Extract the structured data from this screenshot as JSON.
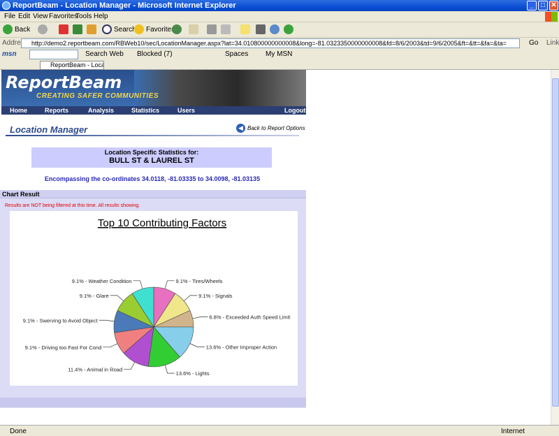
{
  "window": {
    "title": "ReportBeam - Location Manager - Microsoft Internet Explorer",
    "minimize": "_",
    "maximize": "□",
    "close": "✕"
  },
  "menu": [
    "File",
    "Edit",
    "View",
    "Favorites",
    "Tools",
    "Help"
  ],
  "toolbar": {
    "back": "Back",
    "search": "Search",
    "favorites": "Favorites"
  },
  "address": {
    "label": "Address",
    "url": "http://demo2.reportbeam.com/RBWeb10/sec/LocationManager.aspx?lat=34.010800000000008&long=-81.0323350000000008&fd=8/6/2003&td=9/6/2005&ft=&tt=&fa=&ta=",
    "go": "Go",
    "links": "Links"
  },
  "msn": {
    "brand": "msn",
    "search_web": "Search Web",
    "blocked": "Blocked (7)",
    "spaces": "Spaces",
    "mymsn": "My MSN"
  },
  "tab": {
    "label": "ReportBeam - Locatio..."
  },
  "page": {
    "logo": "ReportBeam",
    "tagline": "CREATING SAFER COMMUNITIES",
    "nav": [
      "Home",
      "Reports",
      "Analysis",
      "Statistics",
      "Users",
      "Logout"
    ],
    "title": "Location Manager",
    "back_link": "Back to Report Options",
    "stat_label": "Location Specific Statistics for:",
    "location": "BULL ST & LAUREL ST",
    "coords": "Encompassing the co-ordinates 34.0118, -81.03335 to 34.0098, -81.03135",
    "panel_title": "Chart Result",
    "warning": "Results are NOT being filtered at this time. All results showing."
  },
  "status": {
    "left": "Done",
    "zone": "Internet"
  },
  "chart_data": {
    "type": "pie",
    "title": "Top 10 Contributing Factors",
    "slices": [
      {
        "label": "9.1% - Tires/Wheels",
        "value": 9.1,
        "color": "#e870c0"
      },
      {
        "label": "9.1% - Signals",
        "value": 9.1,
        "color": "#f0e68c"
      },
      {
        "label": "6.8% - Exceeded Auth Speed Limit",
        "value": 6.8,
        "color": "#d2b48c"
      },
      {
        "label": "13.6% - Other Improper Action",
        "value": 13.6,
        "color": "#87ceeb"
      },
      {
        "label": "13.6% - Lights",
        "value": 13.6,
        "color": "#32cd32"
      },
      {
        "label": "11.4% - Animal in Road",
        "value": 11.4,
        "color": "#b050d0"
      },
      {
        "label": "9.1% - Driving too Fast For Cond",
        "value": 9.1,
        "color": "#f08080"
      },
      {
        "label": "9.1% - Swerving to Avoid Object",
        "value": 9.1,
        "color": "#4a7ab8"
      },
      {
        "label": "9.1% - Glare",
        "value": 9.1,
        "color": "#9acd32"
      },
      {
        "label": "9.1% - Weather Condition",
        "value": 9.1,
        "color": "#40e0d0"
      }
    ]
  }
}
